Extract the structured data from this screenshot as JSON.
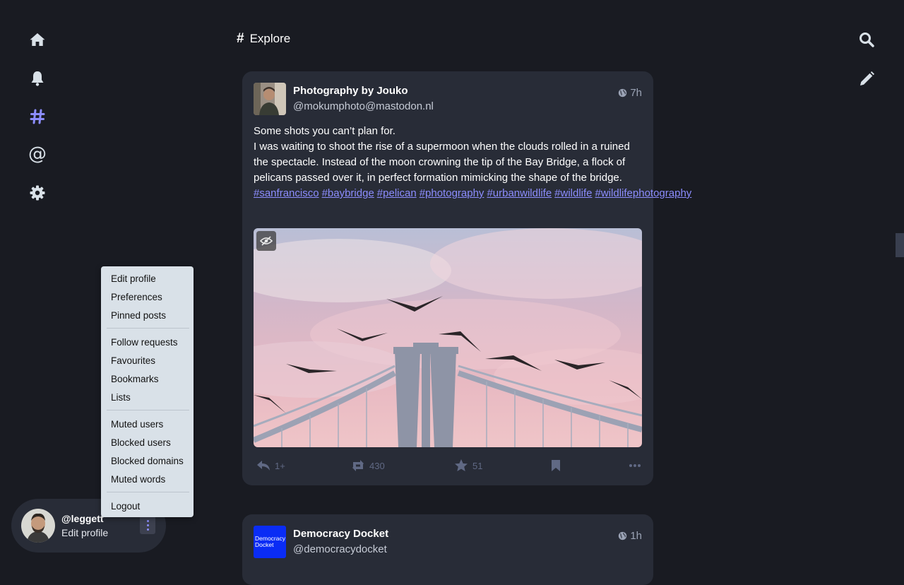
{
  "nav": {
    "home": "home-icon",
    "notifications": "bell-icon",
    "explore": "hashtag-icon",
    "mentions": "@",
    "settings": "gear-icon"
  },
  "header": {
    "icon": "#",
    "title": "Explore"
  },
  "right_bar": {
    "search": "search-icon",
    "compose": "pencil-icon"
  },
  "posts": [
    {
      "author": "Photography by Jouko",
      "handle": "@mokumphoto@mastodon.nl",
      "visibility": "globe-icon",
      "time": "7h",
      "text_lines": [
        "Some shots you can’t plan for.",
        "I was waiting to shoot the rise of a supermoon when the clouds rolled in a ruined the spectacle. Instead of the moon crowning the tip of the Bay Bridge, a flock of pelicans passed over it, in perfect formation mimicking the shape of the bridge."
      ],
      "tags": [
        "#sanfrancisco",
        "#baybridge",
        "#pelican",
        "#photography",
        "#urbanwildlife",
        "#wildlife",
        "#wildlifephotography"
      ],
      "stats": {
        "replies": "1+",
        "boosts": "430",
        "favourites": "51"
      }
    },
    {
      "author": "Democracy Docket",
      "handle": "@democracydocket",
      "avatar_text": [
        "Democracy",
        "Docket"
      ],
      "visibility": "globe-icon",
      "time": "1h"
    }
  ],
  "menu": {
    "group1": [
      "Edit profile",
      "Preferences",
      "Pinned posts"
    ],
    "group2": [
      "Follow requests",
      "Favourites",
      "Bookmarks",
      "Lists"
    ],
    "group3": [
      "Muted users",
      "Blocked users",
      "Blocked domains",
      "Muted words"
    ],
    "group4": [
      "Logout"
    ]
  },
  "account": {
    "username": "@leggett",
    "edit_label": "Edit profile"
  },
  "colors": {
    "background": "#191b22",
    "card": "#282c37",
    "accent": "#8c8dff",
    "menu": "#d9e1e8"
  }
}
